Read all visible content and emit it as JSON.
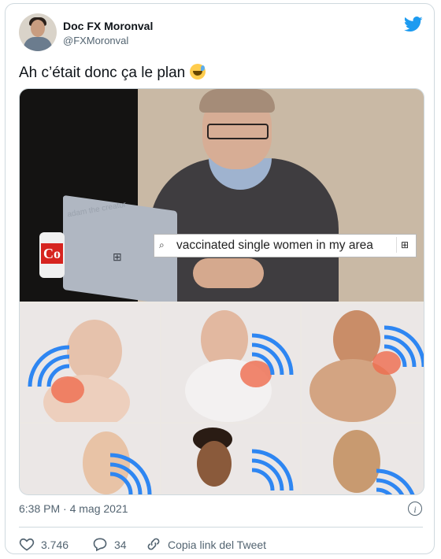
{
  "user": {
    "name": "Doc FX Moronval",
    "handle": "@FXMoronval"
  },
  "tweet": {
    "text": "Ah c’était donc ça le plan"
  },
  "media": {
    "search_query": "vaccinated single women in my area",
    "watermark": "adam the creator",
    "can_logo": "Co"
  },
  "footer": {
    "timestamp": "6:38 PM · 4 mag 2021",
    "likes": "3.746",
    "replies": "34",
    "copy_link": "Copia link del Tweet"
  },
  "colors": {
    "twitter_blue": "#1d9bf0",
    "wifi_blue": "#2e86f2",
    "text_secondary": "#536471"
  },
  "icons": [
    "twitter-bird-icon",
    "info-icon",
    "heart-icon",
    "reply-icon",
    "link-icon",
    "search-icon",
    "windows-icon",
    "wifi-icon"
  ]
}
